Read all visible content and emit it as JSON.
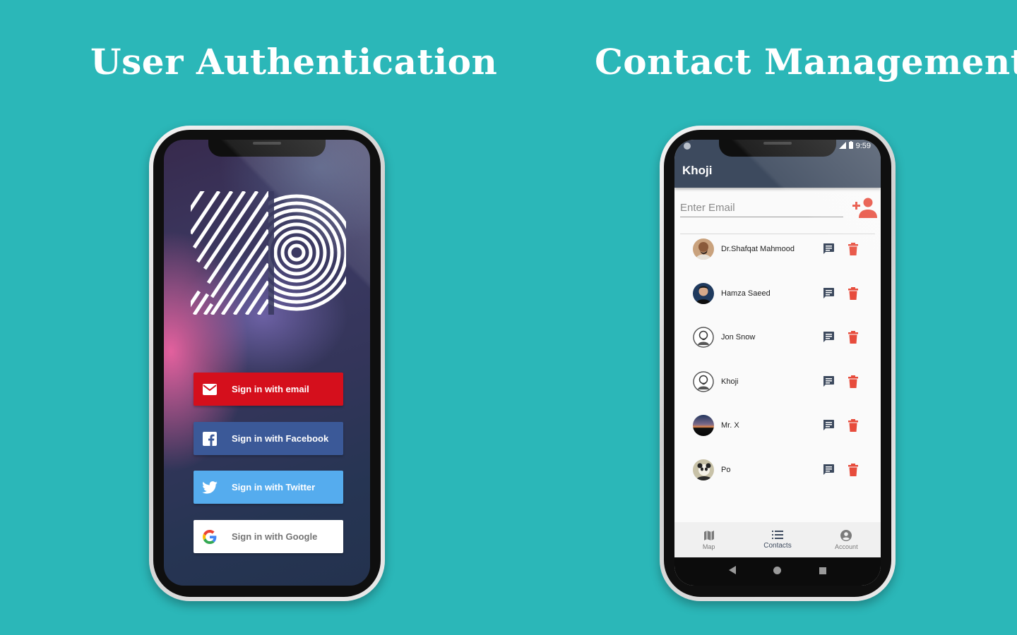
{
  "headlines": {
    "left": "User Authentication",
    "right": "Contact Management"
  },
  "colors": {
    "background": "#2bb7b8",
    "email_button": "#d50f1c",
    "facebook_button": "#3b5998",
    "twitter_button": "#55acee",
    "google_button": "#ffffff",
    "app_bar": "#3d4a5e",
    "accent_red": "#e74c3c"
  },
  "login": {
    "logo_icon": "k-logo-icon",
    "buttons": [
      {
        "label": "Sign in with email",
        "icon": "mail-icon"
      },
      {
        "label": "Sign in with Facebook",
        "icon": "facebook-icon"
      },
      {
        "label": "Sign in with Twitter",
        "icon": "twitter-icon"
      },
      {
        "label": "Sign in with Google",
        "icon": "google-icon"
      }
    ]
  },
  "contacts_app": {
    "status": {
      "time": "9:59"
    },
    "title": "Khoji",
    "email_placeholder": "Enter Email",
    "add_icon": "add-person-icon",
    "contacts": [
      {
        "name": "Dr.Shafqat Mahmood",
        "avatar": "photo-avatar"
      },
      {
        "name": "Hamza Saeed",
        "avatar": "photo-avatar"
      },
      {
        "name": "Jon Snow",
        "avatar": "default-avatar"
      },
      {
        "name": "Khoji",
        "avatar": "default-avatar"
      },
      {
        "name": "Mr. X",
        "avatar": "sunset-avatar"
      },
      {
        "name": "Po",
        "avatar": "panda-avatar"
      }
    ],
    "bottom_nav": [
      {
        "label": "Map",
        "icon": "map-icon"
      },
      {
        "label": "Contacts",
        "icon": "list-icon",
        "active": true
      },
      {
        "label": "Account",
        "icon": "account-icon"
      }
    ]
  }
}
